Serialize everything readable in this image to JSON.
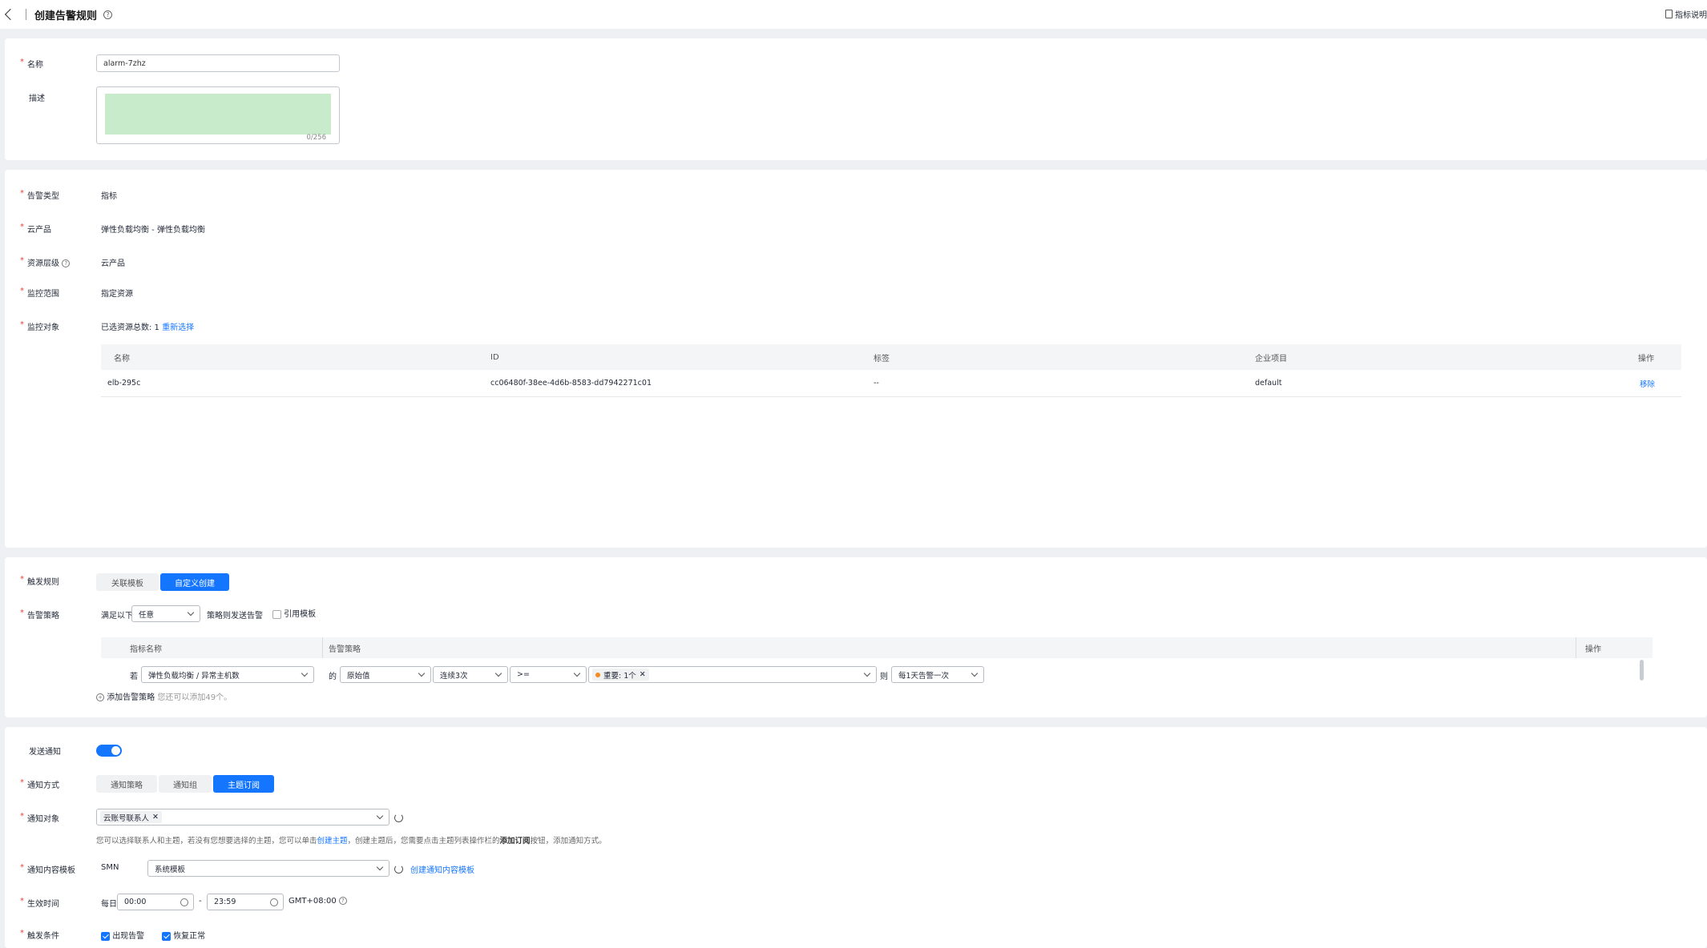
{
  "header": {
    "title": "创建告警规则",
    "right_link": "指标说明"
  },
  "basic": {
    "name_label": "名称",
    "name_value": "alarm-7zhz",
    "desc_label": "描述",
    "desc_counter": "0/256"
  },
  "resource": {
    "alarm_type_label": "告警类型",
    "alarm_type_value": "指标",
    "product_label": "云产品",
    "product_value": "弹性负载均衡 - 弹性负载均衡",
    "level_label": "资源层级",
    "level_value": "云产品",
    "scope_label": "监控范围",
    "scope_value": "指定资源",
    "object_label": "监控对象",
    "object_count": "已选资源总数: 1",
    "reselect": "重新选择",
    "table_headers": [
      "名称",
      "ID",
      "标签",
      "企业项目",
      "操作"
    ],
    "rows": [
      {
        "name": "elb-295c",
        "id": "cc06480f-38ee-4d6b-8583-dd7942271c01",
        "tag": "--",
        "project": "default",
        "action": "移除"
      }
    ]
  },
  "trigger": {
    "rule_label": "触发规则",
    "rule_tabs": [
      "关联模板",
      "自定义创建"
    ],
    "policy_label": "告警策略",
    "satisfy_prefix": "满足以下",
    "satisfy_value": "任意",
    "satisfy_suffix": "策略则发送告警",
    "use_template": "引用模板",
    "table_headers": [
      "指标名称",
      "告警策略",
      "操作"
    ],
    "if_text": "若",
    "metric": "弹性负载均衡 / 异常主机数",
    "of_text": "的",
    "stat": "原始值",
    "period": "连续3次",
    "operator": ">=",
    "severity_tag": "重要: 1个",
    "then_text": "则",
    "frequency": "每1天告警一次",
    "add_policy": "添加告警策略",
    "add_hint": "您还可以添加49个。"
  },
  "notify": {
    "send_label": "发送通知",
    "method_label": "通知方式",
    "method_tabs": [
      "通知策略",
      "通知组",
      "主题订阅"
    ],
    "object_label": "通知对象",
    "object_tag": "云账号联系人",
    "hint_1": "您可以选择联系人和主题，若没有您想要选择的主题，您可以单击",
    "hint_link": "创建主题",
    "hint_2": "，创建主题后，您需要点击主题列表操作栏的",
    "hint_bold": "添加订阅",
    "hint_3": "按钮，添加通知方式。",
    "template_label": "通知内容模板",
    "template_prefix": "SMN",
    "template_value": "系统模板",
    "create_template": "创建通知内容模板",
    "time_label": "生效时间",
    "time_prefix": "每日",
    "time_start": "00:00",
    "time_dash": "-",
    "time_end": "23:59",
    "timezone": "GMT+08:00",
    "cond_label": "触发条件",
    "cond_alarm": "出现告警",
    "cond_recover": "恢复正常"
  },
  "colors": {
    "accent": "#1476ff",
    "required": "#e6423a",
    "desc_fill": "#c8ebcc"
  }
}
